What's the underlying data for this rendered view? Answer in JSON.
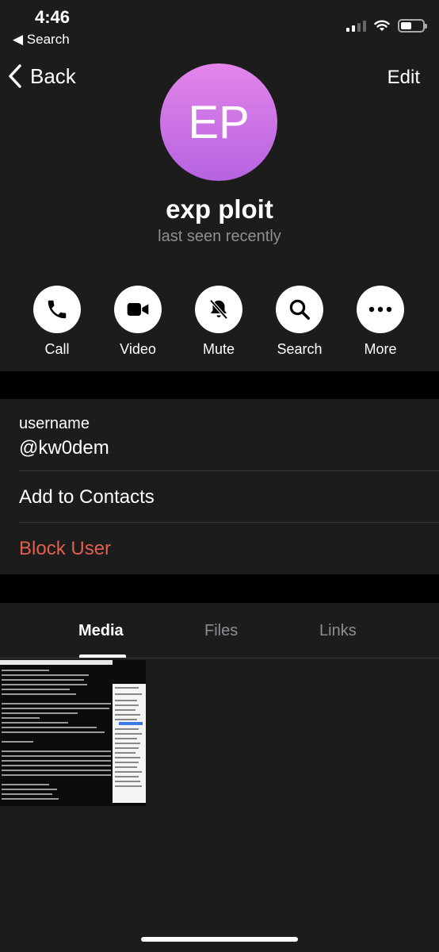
{
  "status_bar": {
    "time": "4:46",
    "back_app": "◀ Search"
  },
  "nav": {
    "back_label": "Back",
    "edit_label": "Edit"
  },
  "profile": {
    "initials": "EP",
    "name": "exp ploit",
    "status": "last seen recently",
    "avatar_gradient": [
      "#e385ea",
      "#b663e0"
    ]
  },
  "actions": [
    {
      "label": "Call",
      "icon": "phone-icon"
    },
    {
      "label": "Video",
      "icon": "video-camera-icon"
    },
    {
      "label": "Mute",
      "icon": "bell-slash-icon"
    },
    {
      "label": "Search",
      "icon": "magnifier-icon"
    },
    {
      "label": "More",
      "icon": "ellipsis-icon"
    }
  ],
  "info": {
    "username_label": "username",
    "username_value": "@kw0dem",
    "add_contacts": "Add to Contacts",
    "block_user": "Block User"
  },
  "media_tabs": {
    "media": "Media",
    "files": "Files",
    "links": "Links",
    "active": "Media"
  },
  "colors": {
    "accent_danger": "#e15f4c",
    "panel": "#1c1c1d",
    "background": "#000000",
    "secondary_text": "#8e8e93"
  }
}
